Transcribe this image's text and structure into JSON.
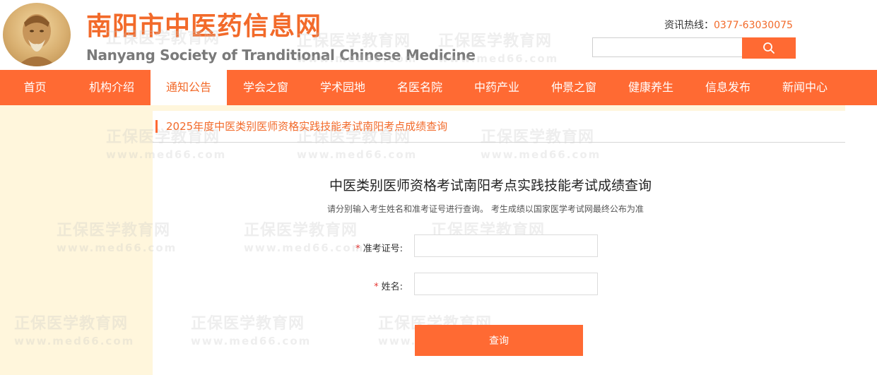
{
  "header": {
    "site_title": "南阳市中医药信息网",
    "site_subtitle": "Nanyang Society of Tranditional Chinese Medicine",
    "hotline_label": "资讯热线：",
    "hotline_number": "0377-63030075",
    "search_placeholder": "",
    "search_icon": "search-icon"
  },
  "nav": {
    "items": [
      {
        "label": "首页"
      },
      {
        "label": "机构介绍"
      },
      {
        "label": "通知公告",
        "active": true
      },
      {
        "label": "学会之窗"
      },
      {
        "label": "学术园地"
      },
      {
        "label": "名医名院"
      },
      {
        "label": "中药产业"
      },
      {
        "label": "仲景之窗"
      },
      {
        "label": "健康养生"
      },
      {
        "label": "信息发布"
      },
      {
        "label": "新闻中心"
      }
    ]
  },
  "page": {
    "heading": "2025年度中医类别医师资格实践技能考试南阳考点成绩查询"
  },
  "form": {
    "title": "中医类别医师资格考试南阳考点实践技能考试成绩查询",
    "note": "请分别输入考生姓名和准考证号进行查询。 考生成绩以国家医学考试网最终公布为准",
    "fields": [
      {
        "required_mark": "*",
        "label": "准考证号:",
        "value": ""
      },
      {
        "required_mark": "*",
        "label": "姓名:",
        "value": ""
      }
    ],
    "submit_label": "查询"
  },
  "watermark": {
    "cn": "正保医学教育网",
    "en": "www.med66.com"
  },
  "colors": {
    "accent": "#ff6a33",
    "title_orange": "#f26a2a",
    "band": "#fff6dc"
  }
}
